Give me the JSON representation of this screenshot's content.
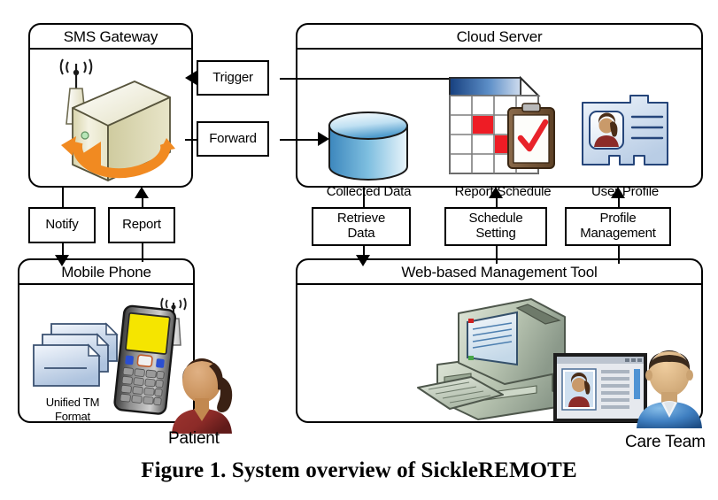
{
  "figure": {
    "caption": "Figure 1. System overview of SickleREMOTE"
  },
  "panels": {
    "sms_gateway": {
      "title": "SMS Gateway"
    },
    "cloud_server": {
      "title": "Cloud Server"
    },
    "mobile_phone": {
      "title": "Mobile Phone"
    },
    "web_tool": {
      "title": "Web-based Management Tool"
    }
  },
  "connectors": [
    {
      "label": "Trigger",
      "direction": "left",
      "from": "cloud-server",
      "to": "sms-gateway"
    },
    {
      "label": "Forward",
      "direction": "right",
      "from": "sms-gateway",
      "to": "collected-data"
    },
    {
      "label": "Notify",
      "direction": "down",
      "from": "sms-gateway",
      "to": "mobile-phone"
    },
    {
      "label": "Report",
      "direction": "up",
      "from": "mobile-phone",
      "to": "sms-gateway"
    },
    {
      "label": "Retrieve\nData",
      "direction": "down",
      "from": "cloud-server",
      "to": "web-tool"
    },
    {
      "label": "Schedule\nSetting",
      "direction": "up",
      "from": "web-tool",
      "to": "report-schedule"
    },
    {
      "label": "Profile\nManagement",
      "direction": "up",
      "from": "web-tool",
      "to": "user-profile"
    }
  ],
  "connector_labels": {
    "trigger": "Trigger",
    "forward": "Forward",
    "notify": "Notify",
    "report": "Report",
    "retrieve_data_l1": "Retrieve",
    "retrieve_data_l2": "Data",
    "schedule_setting_l1": "Schedule",
    "schedule_setting_l2": "Setting",
    "profile_management_l1": "Profile",
    "profile_management_l2": "Management"
  },
  "icons": {
    "sms_server": {
      "name": "sms-gateway-server-icon",
      "caption": ""
    },
    "collected_data": {
      "name": "database-cylinder-icon",
      "caption": "Collected Data"
    },
    "report_schedule": {
      "name": "calendar-clipboard-icon",
      "caption": "Report Schedule"
    },
    "user_profile": {
      "name": "id-card-icon",
      "caption": "User Profile"
    },
    "unified_tm": {
      "name": "documents-stack-icon",
      "caption_l1": "Unified TM",
      "caption_l2": "Format"
    },
    "mobile_handset": {
      "name": "mobile-handset-icon",
      "caption": ""
    },
    "desktop_computer": {
      "name": "desktop-computer-icon",
      "caption": ""
    }
  },
  "actors": {
    "patient": {
      "label": "Patient",
      "icon": "patient-avatar-icon"
    },
    "care_team": {
      "label": "Care Team",
      "icon": "care-team-avatar-icon"
    }
  },
  "colors": {
    "stroke": "#000000",
    "background": "#ffffff",
    "database_blue": "#3f8fc4",
    "calendar_header_blue": "#1f4e99",
    "calendar_cell_red": "#ee1c25",
    "server_beige": "#e9e6cd",
    "server_arrow_orange": "#f18a21",
    "phone_screen_yellow": "#f5e500",
    "document_blue": "#c2d2e8",
    "patient_shirt": "#8c2b28",
    "care_team_shirt": "#3f7fc1",
    "computer_gray": "#b7c3b0"
  }
}
